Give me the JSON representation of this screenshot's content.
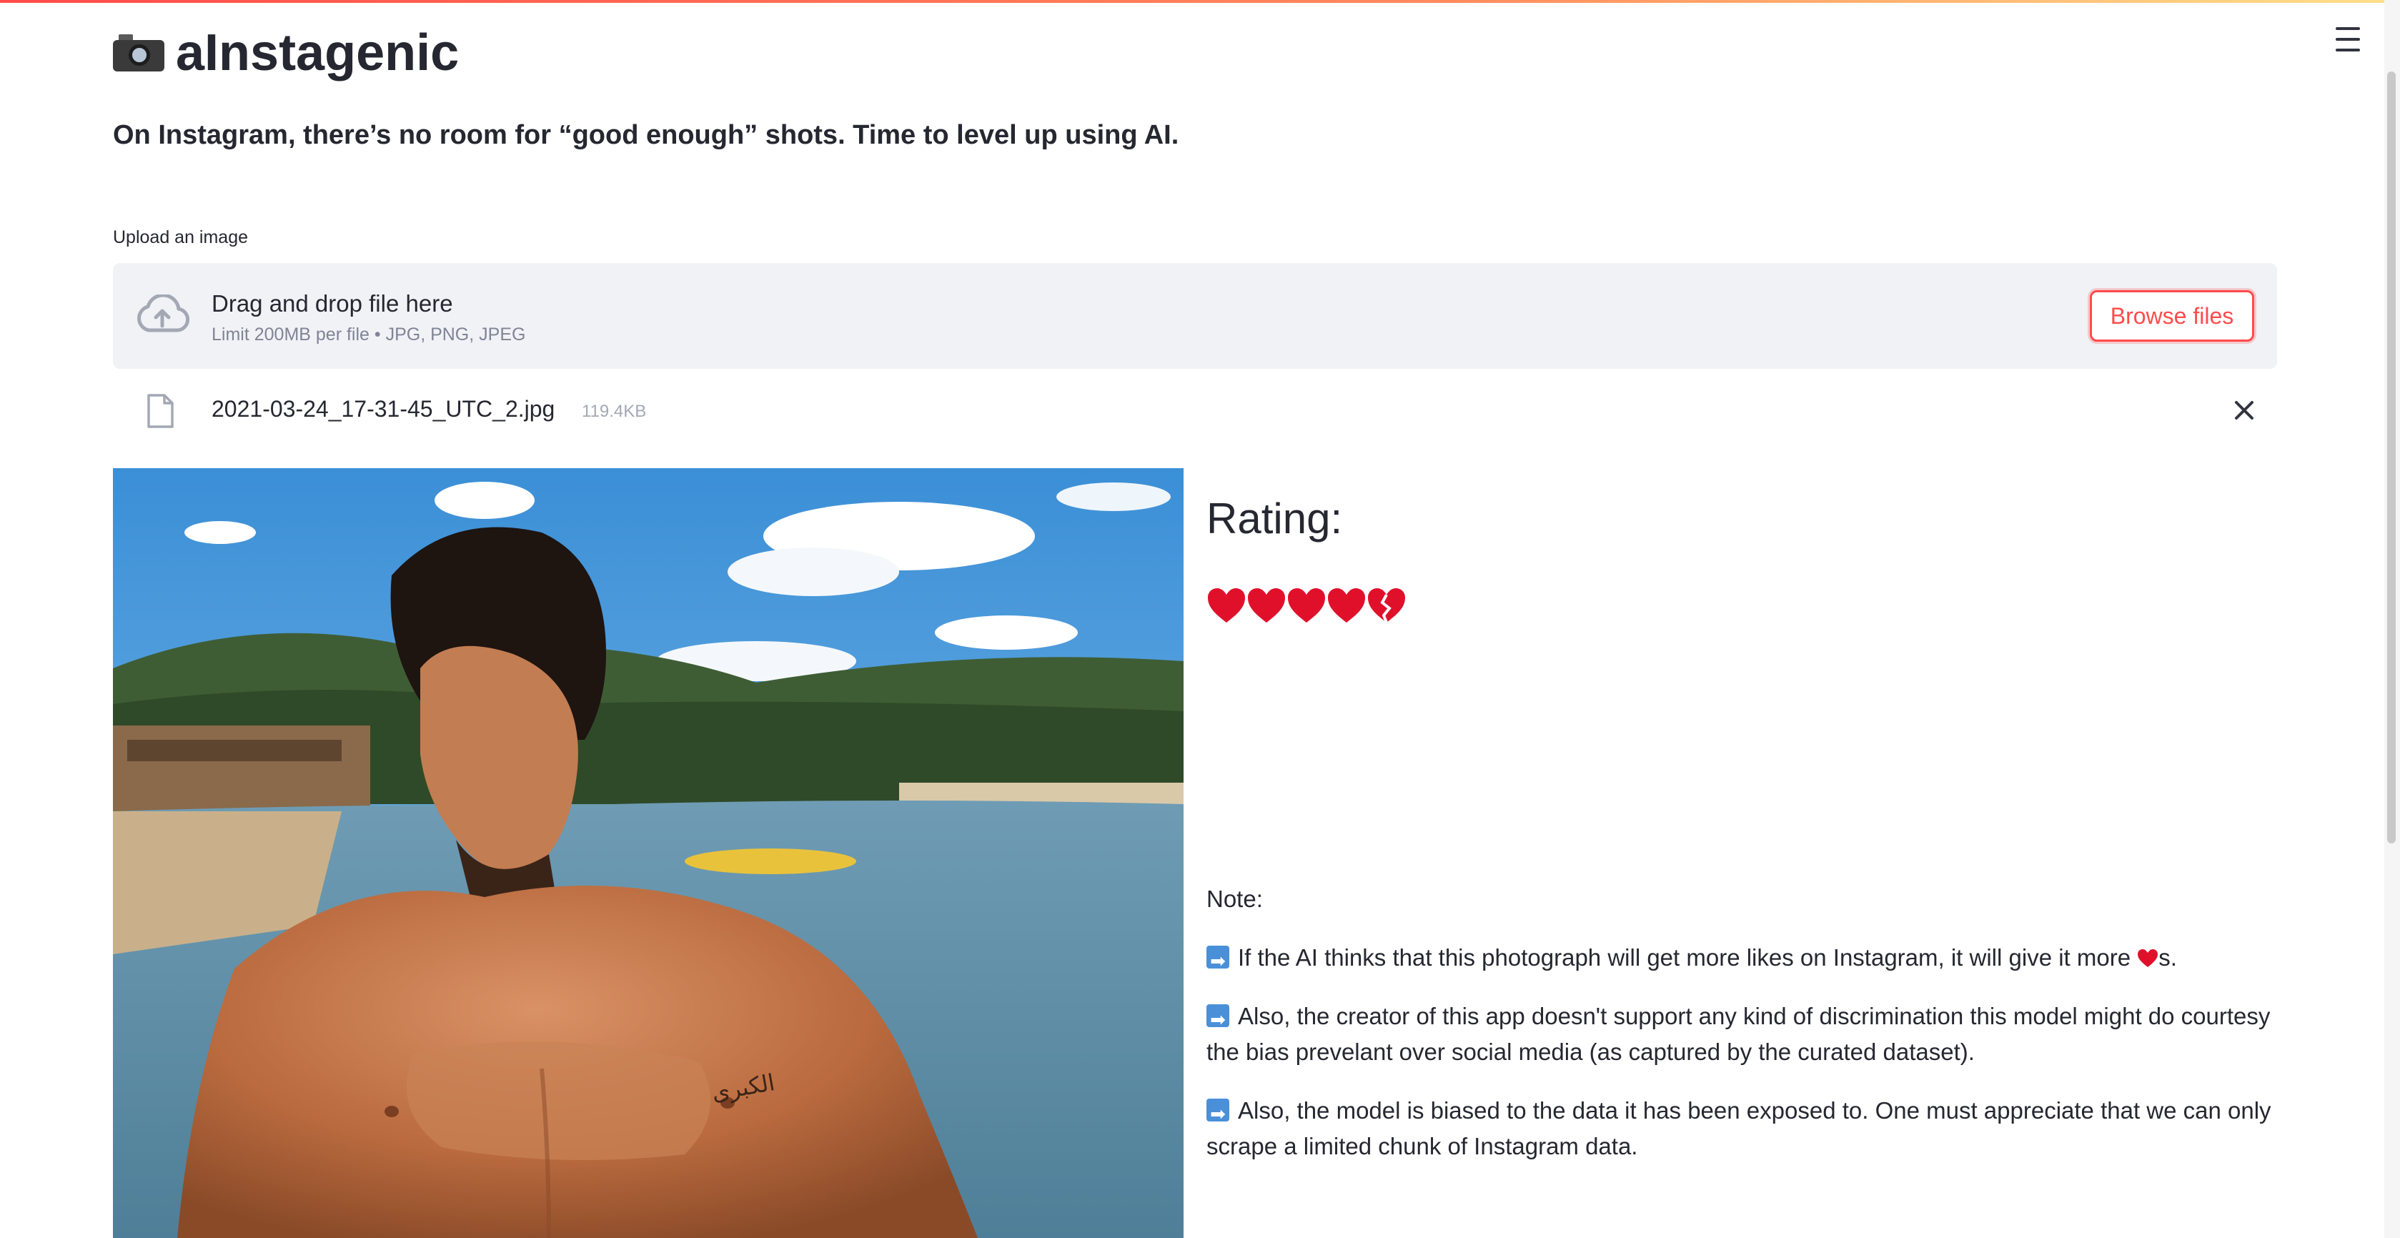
{
  "app": {
    "title": "aInstagenic",
    "subtitle": "On Instagram, there’s no room for “good enough” shots. Time to level up using AI.",
    "menu_icon": "hamburger-menu-icon",
    "title_icon": "camera-icon"
  },
  "uploader": {
    "label": "Upload an image",
    "drop_title": "Drag and drop file here",
    "limit_text": "Limit 200MB per file • JPG, PNG, JPEG",
    "browse_label": "Browse files",
    "file": {
      "name": "2021-03-24_17-31-45_UTC_2.jpg",
      "size": "119.4KB"
    }
  },
  "result": {
    "rating_title": "Rating:",
    "hearts": [
      {
        "kind": "full"
      },
      {
        "kind": "full"
      },
      {
        "kind": "full"
      },
      {
        "kind": "full"
      },
      {
        "kind": "broken"
      }
    ],
    "note_label": "Note:",
    "notes": [
      {
        "before": "If the AI thinks that this photograph will get more likes on Instagram, it will give it more",
        "after": "s."
      },
      {
        "text": "Also, the creator of this app doesn't support any kind of discrimination this model might do courtesy the bias prevelant over social media (as captured by the curated dataset)."
      },
      {
        "text": "Also, the model is biased to the data it has been exposed to. One must appreciate that we can only scrape a limited chunk of Instagram data."
      }
    ]
  },
  "colors": {
    "accent": "#ff4b4b",
    "text": "#262730",
    "muted": "#808495",
    "dropzone_bg": "#f0f2f6",
    "heart": "#e0102b"
  }
}
